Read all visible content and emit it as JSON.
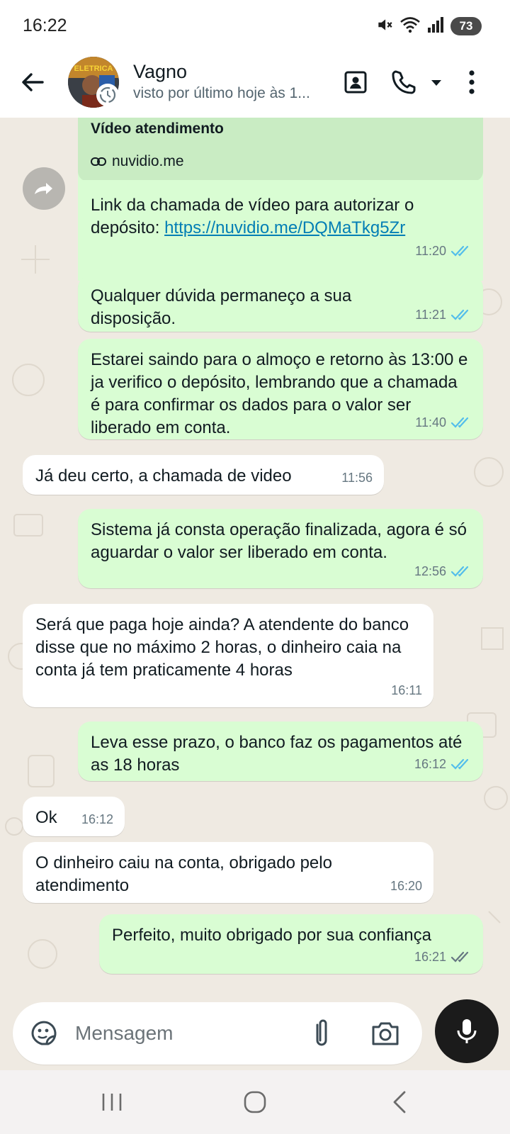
{
  "status_bar": {
    "time": "16:22",
    "battery": "73"
  },
  "header": {
    "contact_name": "Vagno",
    "contact_status": "visto por último hoje às 1...",
    "avatar_badge_text": "ELETRICA"
  },
  "link_preview": {
    "title": "Vídeo atendimento",
    "url": "nuvidio.me"
  },
  "messages": [
    {
      "direction": "out",
      "text": "Link da chamada de vídeo para autorizar o depósito: ",
      "link": "https://nuvidio.me/DQMaTkg5Zr",
      "time": "11:20",
      "status": "read"
    },
    {
      "direction": "out",
      "text": "Qualquer dúvida permaneço a sua disposição.",
      "time": "11:21",
      "status": "read"
    },
    {
      "direction": "out",
      "text": "Estarei saindo para o almoço e retorno às 13:00 e ja verifico o depósito, lembrando que a chamada é para confirmar os dados para o valor ser liberado em conta.",
      "time": "11:40",
      "status": "read"
    },
    {
      "direction": "in",
      "text": "Já deu certo, a chamada de video",
      "time": "11:56"
    },
    {
      "direction": "out",
      "text": "Sistema já consta operação finalizada, agora é só aguardar o valor ser liberado em conta.",
      "time": "12:56",
      "status": "read"
    },
    {
      "direction": "in",
      "text": "Será que paga hoje ainda? A atendente do banco disse que no máximo 2 horas, o dinheiro caia na conta já tem praticamente 4 horas",
      "time": "16:11"
    },
    {
      "direction": "out",
      "text": "Leva esse prazo, o banco faz os pagamentos até as 18 horas",
      "time": "16:12",
      "status": "read"
    },
    {
      "direction": "in",
      "text": "Ok",
      "time": "16:12"
    },
    {
      "direction": "in",
      "text": "O dinheiro caiu na conta, obrigado pelo atendimento",
      "time": "16:20"
    },
    {
      "direction": "out",
      "text": "Perfeito, muito obrigado por sua confiança",
      "time": "16:21",
      "status": "delivered"
    }
  ],
  "input": {
    "placeholder": "Mensagem"
  },
  "colors": {
    "outgoing_bubble": "#d9fdd3",
    "incoming_bubble": "#ffffff",
    "chat_background": "#efeae2",
    "read_tick": "#53bdeb",
    "link": "#027eb5"
  }
}
